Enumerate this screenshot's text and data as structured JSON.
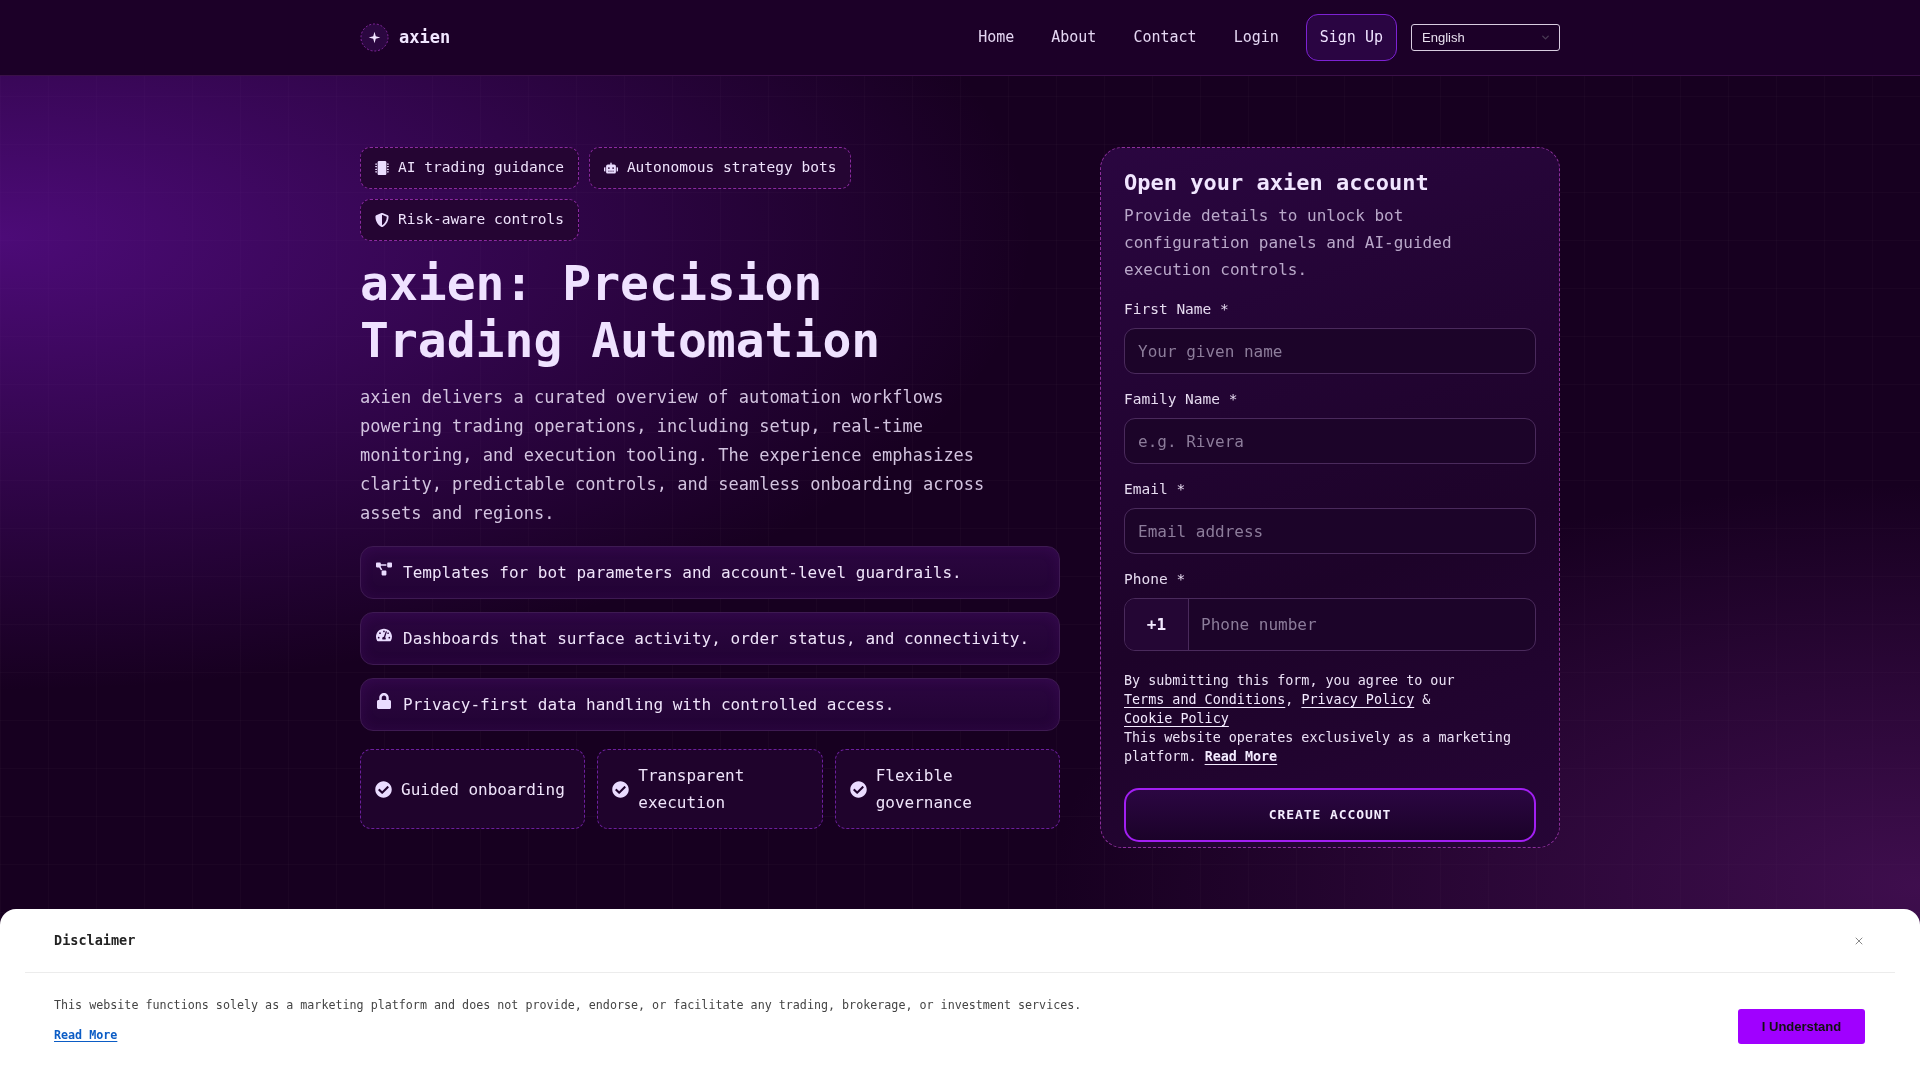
{
  "header": {
    "logo": "axien",
    "nav": [
      {
        "label": "Home"
      },
      {
        "label": "About"
      },
      {
        "label": "Contact"
      },
      {
        "label": "Login"
      }
    ],
    "signup_button": "Sign Up",
    "language_select": "English"
  },
  "hero": {
    "badges": [
      {
        "label": "AI trading guidance"
      },
      {
        "label": "Autonomous strategy bots"
      },
      {
        "label": "Risk-aware controls"
      }
    ],
    "title": "axien: Precision Trading Automation",
    "description": "axien delivers a curated overview of automation workflows powering trading operations, including setup, real-time monitoring, and execution tooling. The experience emphasizes clarity, predictable controls, and seamless onboarding across assets and regions.",
    "features": [
      {
        "text": "Templates for bot parameters and account-level guardrails."
      },
      {
        "text": "Dashboards that surface activity, order status, and connectivity."
      },
      {
        "text": "Privacy-first data handling with controlled access."
      }
    ],
    "highlights": [
      {
        "label": "Guided onboarding"
      },
      {
        "label": "Transparent execution"
      },
      {
        "label": "Flexible governance"
      }
    ]
  },
  "signup_form": {
    "title": "Open your axien account",
    "subtitle": "Provide details to unlock bot configuration panels and AI-guided execution controls.",
    "fields": [
      {
        "kind": "text",
        "label": "First Name *",
        "placeholder": "Your given name"
      },
      {
        "kind": "text",
        "label": "Family Name *",
        "placeholder": "e.g. Rivera"
      },
      {
        "kind": "text",
        "label": "Email *",
        "placeholder": "Email address"
      },
      {
        "kind": "phone",
        "label": "Phone *",
        "prefix": "+1",
        "placeholder": "Phone number"
      }
    ],
    "consent": [
      {
        "kind": "text",
        "text": "By submitting this form, you agree to our "
      },
      {
        "kind": "link",
        "text": "Terms and Conditions"
      },
      {
        "kind": "text",
        "text": ", "
      },
      {
        "kind": "link",
        "text": "Privacy Policy"
      },
      {
        "kind": "text",
        "text": " & "
      },
      {
        "kind": "link",
        "text": "Cookie Policy"
      }
    ],
    "notice": [
      {
        "kind": "text",
        "text": "This website operates exclusively as a marketing platform. "
      },
      {
        "kind": "link",
        "text": "Read More"
      }
    ],
    "submit_button": "CREATE ACCOUNT"
  },
  "disclaimer": {
    "title": "Disclaimer",
    "text": "This website functions solely as a marketing platform and does not provide, endorse, or facilitate any trading, brokerage, or investment services.",
    "link": "Read More",
    "button": "I Understand"
  }
}
